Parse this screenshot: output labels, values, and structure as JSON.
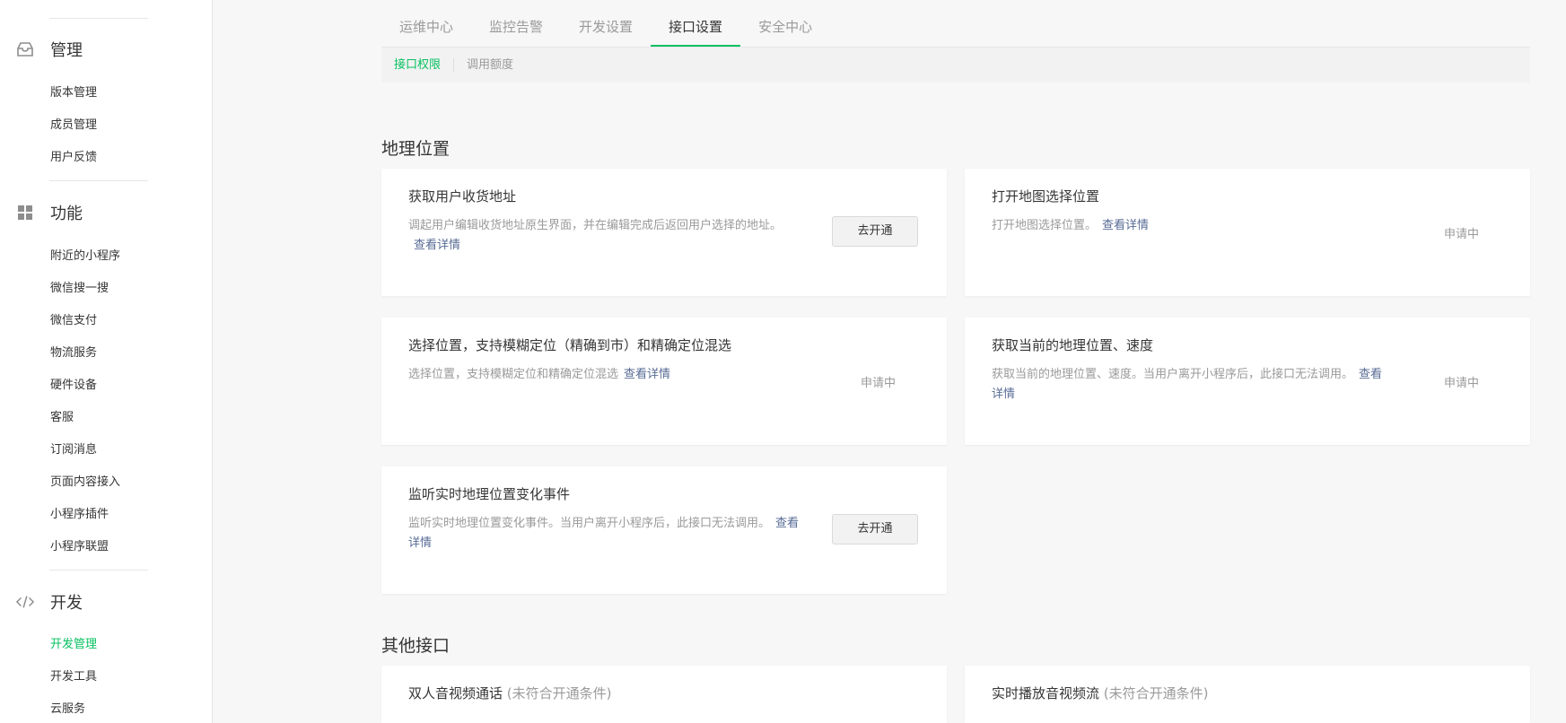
{
  "sidebar": {
    "groups": [
      {
        "label": "管理",
        "icon": "inbox-icon"
      },
      {
        "label": "功能",
        "icon": "grid-icon"
      },
      {
        "label": "开发",
        "icon": "code-icon"
      }
    ],
    "manage_items": [
      "版本管理",
      "成员管理",
      "用户反馈"
    ],
    "feature_items": [
      "附近的小程序",
      "微信搜一搜",
      "微信支付",
      "物流服务",
      "硬件设备",
      "客服",
      "订阅消息",
      "页面内容接入",
      "小程序插件",
      "小程序联盟"
    ],
    "dev_items": [
      "开发管理",
      "开发工具",
      "云服务"
    ],
    "active_item": "开发管理",
    "accent_color": "#07c160"
  },
  "tabs": [
    "运维中心",
    "监控告警",
    "开发设置",
    "接口设置",
    "安全中心"
  ],
  "active_tab": "接口设置",
  "subtabs": [
    "接口权限",
    "调用额度"
  ],
  "active_subtab": "接口权限",
  "sections": {
    "geo": {
      "title": "地理位置",
      "cards": [
        {
          "title": "获取用户收货地址",
          "desc": "调起用户编辑收货地址原生界面，并在编辑完成后返回用户选择的地址。",
          "link": "查看详情",
          "action": "去开通"
        },
        {
          "title": "打开地图选择位置",
          "desc": "打开地图选择位置。",
          "link": "查看详情",
          "status": "申请中"
        },
        {
          "title": "选择位置，支持模糊定位（精确到市）和精确定位混选",
          "desc": "选择位置，支持模糊定位和精确定位混选",
          "link": "查看详情",
          "status": "申请中"
        },
        {
          "title": "获取当前的地理位置、速度",
          "desc": "获取当前的地理位置、速度。当用户离开小程序后，此接口无法调用。",
          "link": "查看详情",
          "status": "申请中"
        },
        {
          "title": "监听实时地理位置变化事件",
          "desc": "监听实时地理位置变化事件。当用户离开小程序后，此接口无法调用。",
          "link": "查看详情",
          "action": "去开通"
        }
      ]
    },
    "other": {
      "title": "其他接口",
      "cards": [
        {
          "title": "双人音视频通话",
          "note": "(未符合开通条件)"
        },
        {
          "title": "实时播放音视频流",
          "note": "(未符合开通条件)"
        }
      ]
    }
  }
}
